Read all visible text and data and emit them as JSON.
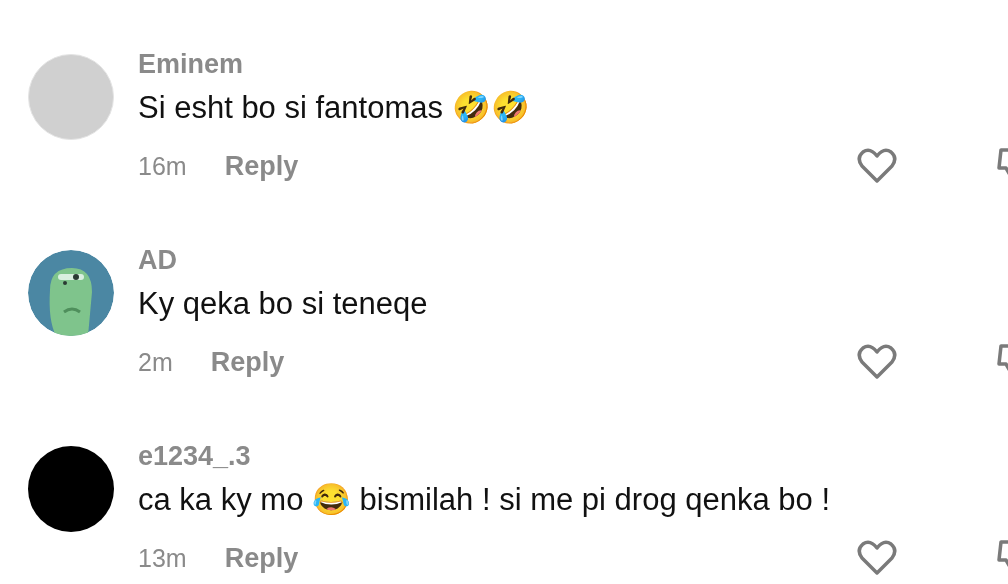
{
  "comments": [
    {
      "avatar": {
        "kind": "photo"
      },
      "username": "Eminem",
      "text": "Si esht bo si fantomas 🤣🤣",
      "time": "16m",
      "reply": "Reply"
    },
    {
      "avatar": {
        "kind": "cartoon"
      },
      "username": "AD",
      "text": "Ky qeka bo si teneqe",
      "time": "2m",
      "reply": "Reply"
    },
    {
      "avatar": {
        "kind": "blank"
      },
      "username": "e1234_.3",
      "text": "ca ka ky mo 😂 bismilah ! si me pi drog qenka bo !",
      "time": "13m",
      "reply": "Reply"
    }
  ]
}
